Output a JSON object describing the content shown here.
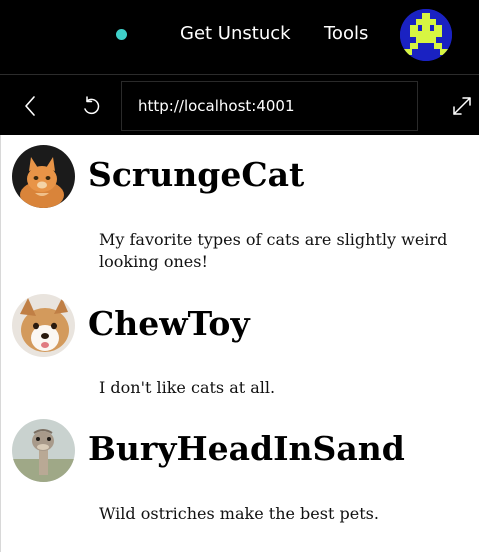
{
  "nav": {
    "links": [
      "Get Unstuck",
      "Tools"
    ],
    "status_color": "#3fd0c9",
    "avatar_icon": "pixel-invader-avatar-icon"
  },
  "browser": {
    "url": "http://localhost:4001",
    "back_icon": "chevron-left-icon",
    "refresh_icon": "refresh-icon",
    "expand_icon": "expand-icon"
  },
  "posts": [
    {
      "name": "ScrungeCat",
      "text": "My favorite types of cats are slightly weird looking ones!",
      "avatar": "cat-avatar"
    },
    {
      "name": "ChewToy",
      "text": "I don't like cats at all.",
      "avatar": "dog-avatar"
    },
    {
      "name": "BuryHeadInSand",
      "text": "Wild ostriches make the best pets.",
      "avatar": "ostrich-avatar"
    }
  ]
}
